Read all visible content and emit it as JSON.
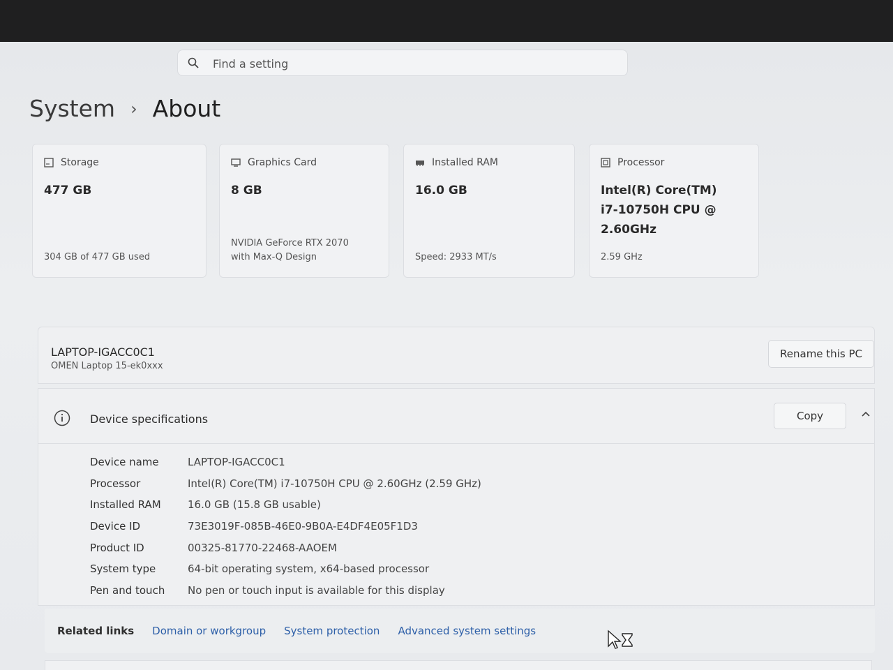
{
  "search": {
    "placeholder": "Find a setting"
  },
  "breadcrumb": {
    "parent": "System",
    "separator": "›",
    "current": "About"
  },
  "cards": [
    {
      "icon": "storage-icon",
      "label": "Storage",
      "value": "477 GB",
      "sub": "304 GB of 477 GB used"
    },
    {
      "icon": "graphics-card-icon",
      "label": "Graphics Card",
      "value": "8 GB",
      "sub": "NVIDIA GeForce RTX 2070 with Max-Q Design"
    },
    {
      "icon": "ram-icon",
      "label": "Installed RAM",
      "value": "16.0 GB",
      "sub": "Speed: 2933 MT/s"
    },
    {
      "icon": "processor-icon",
      "label": "Processor",
      "value": "Intel(R) Core(TM) i7-10750H CPU @ 2.60GHz",
      "sub": "2.59 GHz"
    }
  ],
  "pc": {
    "name": "LAPTOP-IGACC0C1",
    "model": "OMEN Laptop 15-ek0xxx",
    "rename_label": "Rename this PC"
  },
  "specs": {
    "title": "Device specifications",
    "copy_label": "Copy",
    "rows": [
      {
        "label": "Device name",
        "value": "LAPTOP-IGACC0C1"
      },
      {
        "label": "Processor",
        "value": "Intel(R) Core(TM) i7-10750H CPU @ 2.60GHz (2.59 GHz)"
      },
      {
        "label": "Installed RAM",
        "value": "16.0 GB (15.8 GB usable)"
      },
      {
        "label": "Device ID",
        "value": "73E3019F-085B-46E0-9B0A-E4DF4E05F1D3"
      },
      {
        "label": "Product ID",
        "value": "00325-81770-22468-AAOEM"
      },
      {
        "label": "System type",
        "value": "64-bit operating system, x64-based processor"
      },
      {
        "label": "Pen and touch",
        "value": "No pen or touch input is available for this display"
      }
    ]
  },
  "related": {
    "label": "Related links",
    "links": [
      "Domain or workgroup",
      "System protection",
      "Advanced system settings"
    ]
  },
  "colors": {
    "link": "#2d5fa8",
    "background": "#e9ebee",
    "card": "#f1f2f4"
  }
}
